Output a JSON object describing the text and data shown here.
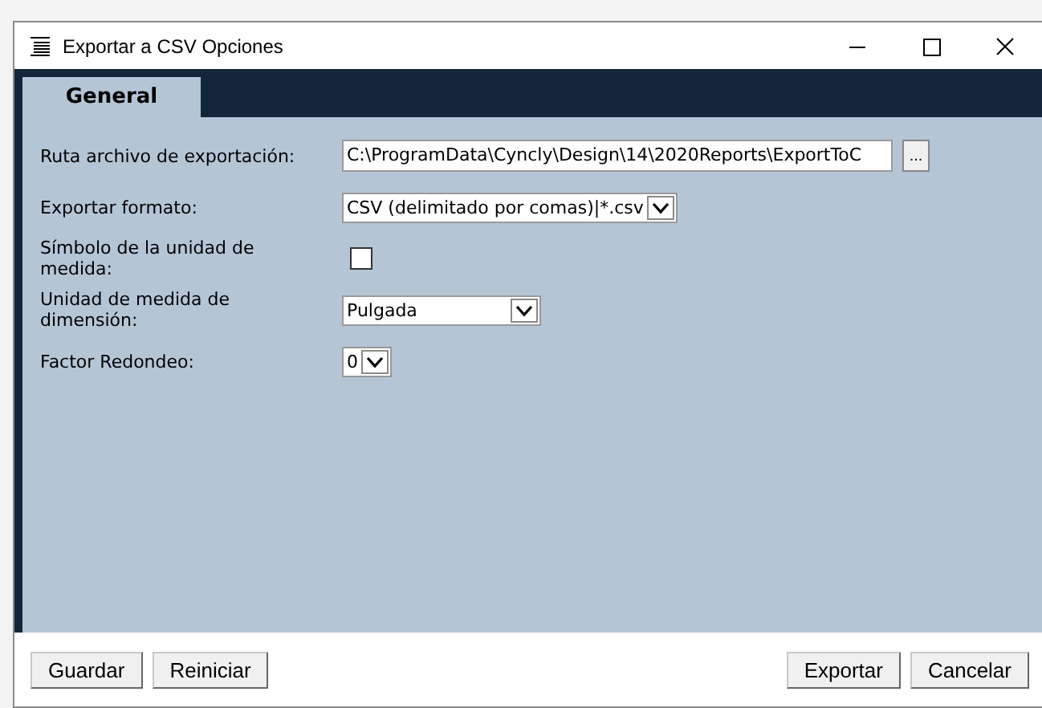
{
  "window": {
    "title": "Exportar a CSV Opciones"
  },
  "tabs": [
    {
      "label": "General",
      "selected": true
    }
  ],
  "fields": [
    {
      "kind": "path",
      "label": "Ruta archivo de exportación:",
      "value": "C:\\ProgramData\\Cyncly\\Design\\14\\2020Reports\\ExportToC",
      "browse": "..."
    },
    {
      "kind": "select",
      "label": "Exportar formato:",
      "value": "CSV (delimitado por comas)|*.csv"
    },
    {
      "kind": "checkbox",
      "label": "Símbolo de la unidad de medida:",
      "checked": false
    },
    {
      "kind": "select",
      "label": "Unidad de medida de dimensión:",
      "value": "Pulgada"
    },
    {
      "kind": "select",
      "label": "Factor Redondeo:",
      "value": "0"
    }
  ],
  "buttons_left": [
    "Guardar",
    "Reiniciar"
  ],
  "buttons_right": [
    "Exportar",
    "Cancelar"
  ]
}
